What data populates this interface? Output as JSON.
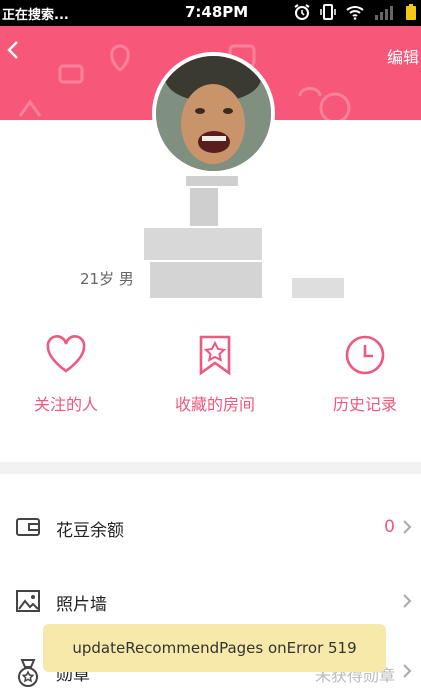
{
  "status_bar": {
    "left_text": "正在搜索...",
    "time": "7:48PM"
  },
  "header": {
    "edit_label": "编辑",
    "back_icon": "chevron-left-icon"
  },
  "profile": {
    "age_gender": "21岁 男"
  },
  "actions": [
    {
      "label": "关注的人",
      "icon": "heart-icon"
    },
    {
      "label": "收藏的房间",
      "icon": "bookmark-star-icon"
    },
    {
      "label": "历史记录",
      "icon": "clock-icon"
    }
  ],
  "menu": [
    {
      "label": "花豆余额",
      "value": "0",
      "icon": "wallet-icon"
    },
    {
      "label": "照片墙",
      "value": "",
      "icon": "image-icon"
    },
    {
      "label": "勋章",
      "value": "未获得勋章",
      "icon": "medal-icon"
    }
  ],
  "toast": {
    "message": "updateRecommendPages onError 519"
  },
  "colors": {
    "accent": "#f0587f",
    "header_bg": "#f7587a"
  }
}
